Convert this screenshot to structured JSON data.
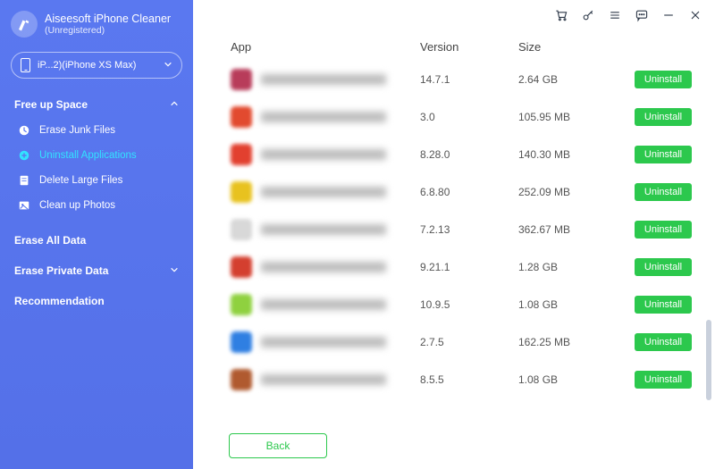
{
  "app": {
    "title": "Aiseesoft iPhone Cleaner",
    "subtitle": "(Unregistered)"
  },
  "device": {
    "label": "iP...2)(iPhone XS Max)"
  },
  "sidebar": {
    "section1": {
      "title": "Free up Space"
    },
    "items": [
      {
        "label": "Erase Junk Files"
      },
      {
        "label": "Uninstall Applications"
      },
      {
        "label": "Delete Large Files"
      },
      {
        "label": "Clean up Photos"
      }
    ],
    "eraseAll": "Erase All Data",
    "erasePrivate": "Erase Private Data",
    "recommendation": "Recommendation"
  },
  "table": {
    "headers": {
      "app": "App",
      "version": "Version",
      "size": "Size"
    },
    "uninstall_label": "Uninstall",
    "rows": [
      {
        "version": "14.7.1",
        "size": "2.64 GB",
        "color": "#b83c5a"
      },
      {
        "version": "3.0",
        "size": "105.95 MB",
        "color": "#e24a2f"
      },
      {
        "version": "8.28.0",
        "size": "140.30 MB",
        "color": "#e2402f"
      },
      {
        "version": "6.8.80",
        "size": "252.09 MB",
        "color": "#e8c21f"
      },
      {
        "version": "7.2.13",
        "size": "362.67 MB",
        "color": "#d8d8d8"
      },
      {
        "version": "9.21.1",
        "size": "1.28 GB",
        "color": "#d43f2f"
      },
      {
        "version": "10.9.5",
        "size": "1.08 GB",
        "color": "#8fd13f"
      },
      {
        "version": "2.7.5",
        "size": "162.25 MB",
        "color": "#2f7fe2"
      },
      {
        "version": "8.5.5",
        "size": "1.08 GB",
        "color": "#b05a2f"
      }
    ]
  },
  "footer": {
    "back": "Back"
  }
}
